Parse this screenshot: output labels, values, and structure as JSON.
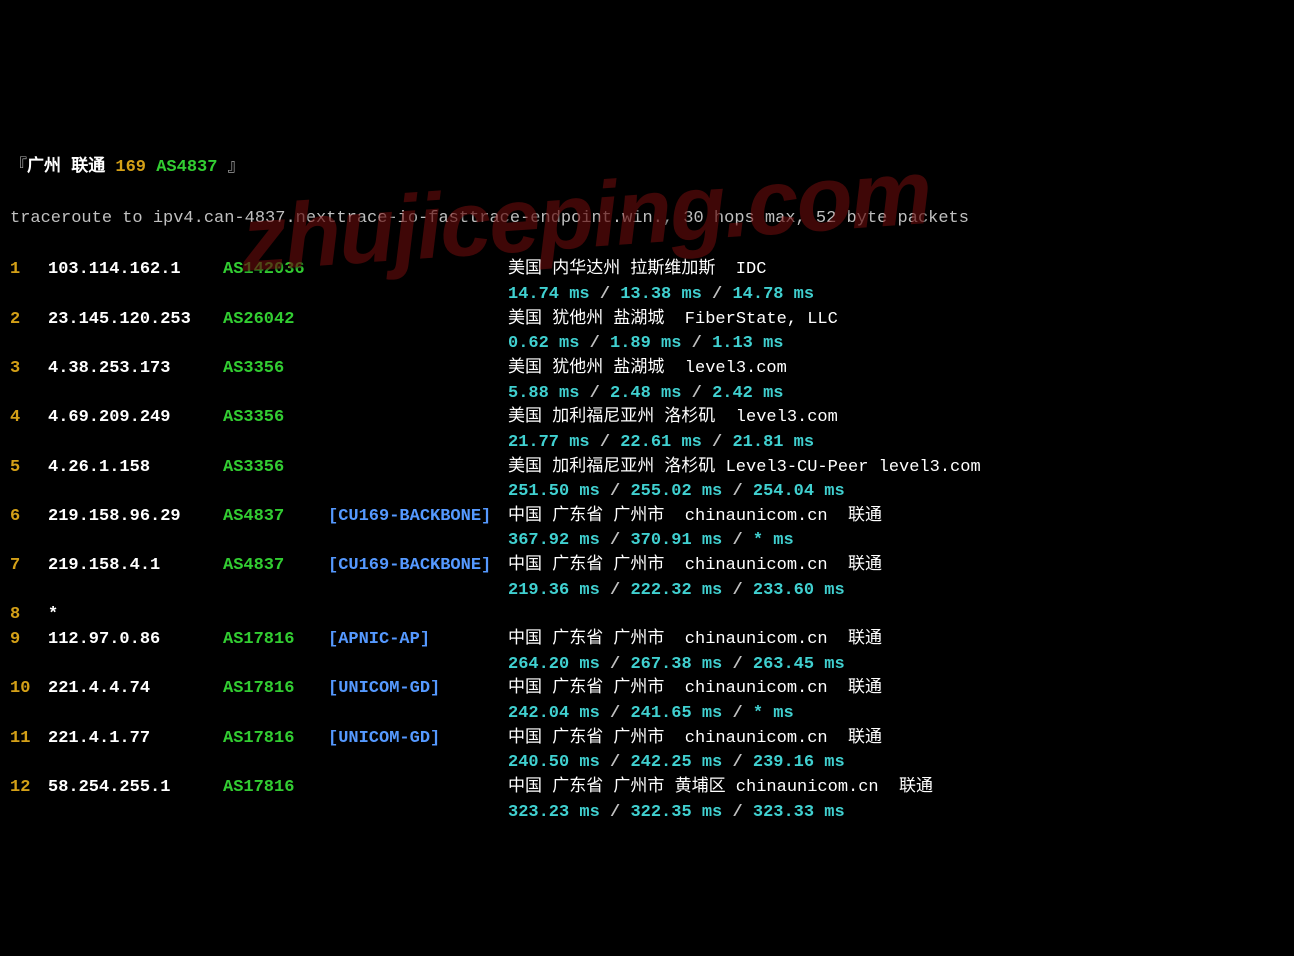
{
  "header": {
    "bracket_open": "『",
    "location": "广州",
    "isp": "联通",
    "route_num": "169",
    "as": "AS4837",
    "bracket_close": "』"
  },
  "command": "traceroute to ipv4.can-4837.nexttrace-io-fasttrace-endpoint.win., 30 hops max, 52 byte packets",
  "watermark": "zhujiceping.com",
  "hops": [
    {
      "num": "1",
      "ip": "103.114.162.1",
      "as": "AS142036",
      "tag": "",
      "location": "美国 内华达州 拉斯维加斯  IDC",
      "latency": [
        "14.74 ms",
        "13.38 ms",
        "14.78 ms"
      ]
    },
    {
      "num": "2",
      "ip": "23.145.120.253",
      "as": "AS26042",
      "tag": "",
      "location": "美国 犹他州 盐湖城  FiberState, LLC",
      "latency": [
        "0.62 ms",
        "1.89 ms",
        "1.13 ms"
      ]
    },
    {
      "num": "3",
      "ip": "4.38.253.173",
      "as": "AS3356",
      "tag": "",
      "location": "美国 犹他州 盐湖城  level3.com",
      "latency": [
        "5.88 ms",
        "2.48 ms",
        "2.42 ms"
      ]
    },
    {
      "num": "4",
      "ip": "4.69.209.249",
      "as": "AS3356",
      "tag": "",
      "location": "美国 加利福尼亚州 洛杉矶  level3.com",
      "latency": [
        "21.77 ms",
        "22.61 ms",
        "21.81 ms"
      ]
    },
    {
      "num": "5",
      "ip": "4.26.1.158",
      "as": "AS3356",
      "tag": "",
      "location": "美国 加利福尼亚州 洛杉矶 Level3-CU-Peer level3.com",
      "latency": [
        "251.50 ms",
        "255.02 ms",
        "254.04 ms"
      ]
    },
    {
      "num": "6",
      "ip": "219.158.96.29",
      "as": "AS4837",
      "tag": "[CU169-BACKBONE]",
      "location": "中国 广东省 广州市  chinaunicom.cn  联通",
      "latency": [
        "367.92 ms",
        "370.91 ms",
        "* ms"
      ]
    },
    {
      "num": "7",
      "ip": "219.158.4.1",
      "as": "AS4837",
      "tag": "[CU169-BACKBONE]",
      "location": "中国 广东省 广州市  chinaunicom.cn  联通",
      "latency": [
        "219.36 ms",
        "222.32 ms",
        "233.60 ms"
      ]
    },
    {
      "num": "8",
      "ip": "*",
      "as": "",
      "tag": "",
      "location": "",
      "latency": null
    },
    {
      "num": "9",
      "ip": "112.97.0.86",
      "as": "AS17816",
      "tag": "[APNIC-AP]",
      "location": "中国 广东省 广州市  chinaunicom.cn  联通",
      "latency": [
        "264.20 ms",
        "267.38 ms",
        "263.45 ms"
      ]
    },
    {
      "num": "10",
      "ip": "221.4.4.74",
      "as": "AS17816",
      "tag": "[UNICOM-GD]",
      "location": "中国 广东省 广州市  chinaunicom.cn  联通",
      "latency": [
        "242.04 ms",
        "241.65 ms",
        "* ms"
      ]
    },
    {
      "num": "11",
      "ip": "221.4.1.77",
      "as": "AS17816",
      "tag": "[UNICOM-GD]",
      "location": "中国 广东省 广州市  chinaunicom.cn  联通",
      "latency": [
        "240.50 ms",
        "242.25 ms",
        "239.16 ms"
      ]
    },
    {
      "num": "12",
      "ip": "58.254.255.1",
      "as": "AS17816",
      "tag": "",
      "location": "中国 广东省 广州市 黄埔区 chinaunicom.cn  联通",
      "latency": [
        "323.23 ms",
        "322.35 ms",
        "323.33 ms"
      ]
    }
  ]
}
